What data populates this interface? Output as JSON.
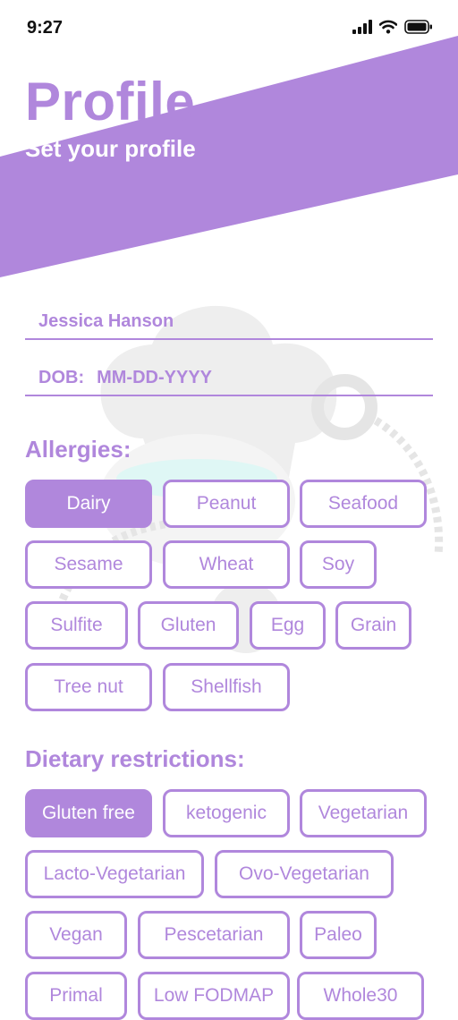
{
  "status_bar": {
    "time": "9:27"
  },
  "header": {
    "title": "Profile",
    "subtitle": "Set your profile"
  },
  "form": {
    "name": "Jessica Hanson",
    "dob_label": "DOB:",
    "dob_placeholder": "MM-DD-YYYY"
  },
  "allergies": {
    "heading": "Allergies:",
    "options": [
      {
        "label": "Dairy",
        "selected": true
      },
      {
        "label": "Peanut",
        "selected": false
      },
      {
        "label": "Seafood",
        "selected": false
      },
      {
        "label": "Sesame",
        "selected": false
      },
      {
        "label": "Wheat",
        "selected": false
      },
      {
        "label": "Soy",
        "selected": false
      },
      {
        "label": "Sulfite",
        "selected": false
      },
      {
        "label": "Gluten",
        "selected": false
      },
      {
        "label": "Egg",
        "selected": false
      },
      {
        "label": "Grain",
        "selected": false
      },
      {
        "label": "Tree nut",
        "selected": false
      },
      {
        "label": "Shellfish",
        "selected": false
      }
    ]
  },
  "dietary": {
    "heading": "Dietary restrictions:",
    "options": [
      {
        "label": "Gluten free",
        "selected": true
      },
      {
        "label": "ketogenic",
        "selected": false
      },
      {
        "label": "Vegetarian",
        "selected": false
      },
      {
        "label": "Lacto-Vegetarian",
        "selected": false
      },
      {
        "label": "Ovo-Vegetarian",
        "selected": false
      },
      {
        "label": "Vegan",
        "selected": false
      },
      {
        "label": "Pescetarian",
        "selected": false
      },
      {
        "label": "Paleo",
        "selected": false
      },
      {
        "label": "Primal",
        "selected": false
      },
      {
        "label": "Low FODMAP",
        "selected": false
      },
      {
        "label": "Whole30",
        "selected": false
      }
    ]
  },
  "colors": {
    "accent": "#b087dc",
    "background": "#ffffff",
    "watermark_teal": "#3fd3c3"
  },
  "icons": [
    "signal-icon",
    "wifi-icon",
    "battery-icon",
    "chef-hat-watermark-icon"
  ]
}
